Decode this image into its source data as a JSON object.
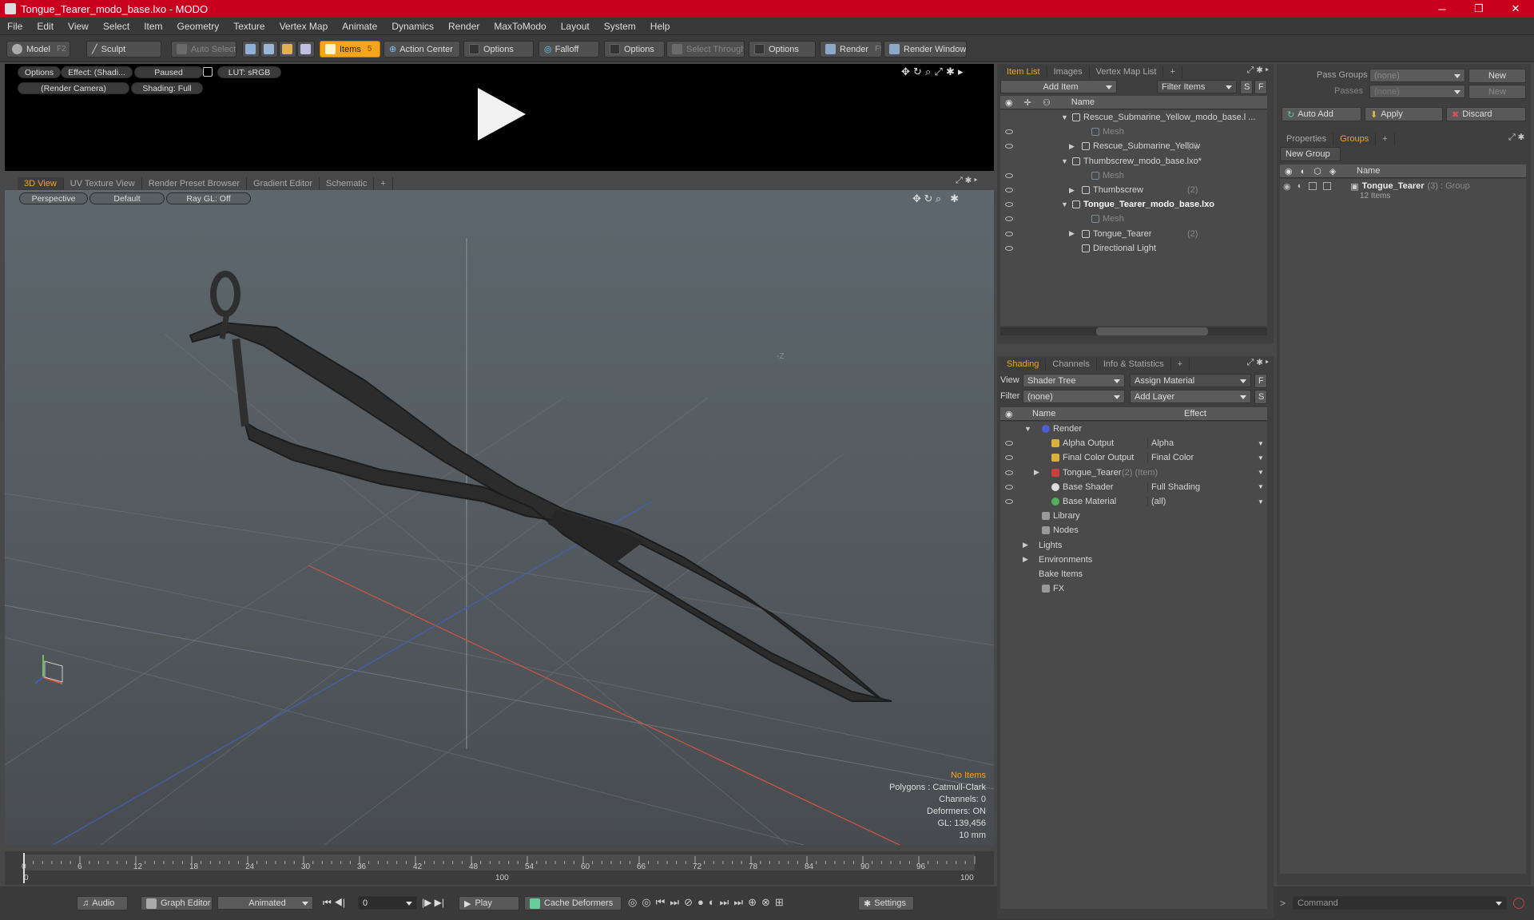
{
  "window": {
    "title": "Tongue_Tearer_modo_base.lxo - MODO",
    "controls": [
      "─",
      "❐",
      "✕"
    ]
  },
  "menu": [
    "File",
    "Edit",
    "View",
    "Select",
    "Item",
    "Geometry",
    "Texture",
    "Vertex Map",
    "Animate",
    "Dynamics",
    "Render",
    "MaxToModo",
    "Layout",
    "System",
    "Help"
  ],
  "toolbar": {
    "model": "Model",
    "model_key": "F2",
    "sculpt": "Sculpt",
    "auto_select": "Auto Select",
    "items": "Items",
    "items_key": "5",
    "action_center": "Action Center",
    "options1": "Options",
    "falloff": "Falloff",
    "options2": "Options",
    "select_through": "Select Through",
    "options3": "Options",
    "render": "Render",
    "render_key": "F9",
    "render_window": "Render Window"
  },
  "preview": {
    "options": "Options",
    "effect": "Effect: (Shadi...",
    "paused": "Paused",
    "lut": "LUT: sRGB",
    "camera": "(Render Camera)",
    "shading": "Shading: Full"
  },
  "viewport_tabs": [
    "3D View",
    "UV Texture View",
    "Render Preset Browser",
    "Gradient Editor",
    "Schematic",
    "+"
  ],
  "viewport": {
    "perspective": "Perspective",
    "default": "Default",
    "raygl": "Ray GL: Off",
    "axis_label": "-Z",
    "stats": {
      "no_items": "No Items",
      "polygons": "Polygons : Catmull-Clark",
      "channels": "Channels: 0",
      "deformers": "Deformers: ON",
      "gl": "GL: 139,456",
      "scale": "10 mm"
    }
  },
  "timeline": {
    "ticks": [
      "0",
      "6",
      "12",
      "18",
      "24",
      "30",
      "36",
      "42",
      "48",
      "54",
      "60",
      "66",
      "72",
      "78",
      "84",
      "90",
      "96"
    ],
    "lower_left": "0",
    "lower_mid": "100",
    "lower_right": "100"
  },
  "bottombar": {
    "audio": "Audio",
    "graph_editor": "Graph Editor",
    "animated": "Animated",
    "frame": "0",
    "play": "Play",
    "cache": "Cache Deformers",
    "settings": "Settings"
  },
  "itemlist": {
    "tabs": [
      "Item List",
      "Images",
      "Vertex Map List",
      "+"
    ],
    "add_item": "Add Item",
    "filter": "Filter Items",
    "s": "S",
    "f": "F",
    "col_name": "Name",
    "rows": [
      {
        "name": "Rescue_Submarine_Yellow_modo_base.l ...",
        "sub": "",
        "indent": 0,
        "bold": false,
        "arrow": "▼",
        "eye": false
      },
      {
        "name": "Mesh",
        "sub": "",
        "indent": 2,
        "bold": false,
        "arrow": "",
        "eye": true,
        "dim": true
      },
      {
        "name": "Rescue_Submarine_Yellow",
        "sub": "(2)",
        "indent": 1,
        "bold": false,
        "arrow": "▶",
        "eye": true
      },
      {
        "name": "Thumbscrew_modo_base.lxo*",
        "sub": "",
        "indent": 0,
        "bold": false,
        "arrow": "▼",
        "eye": false
      },
      {
        "name": "Mesh",
        "sub": "",
        "indent": 2,
        "bold": false,
        "arrow": "",
        "eye": true,
        "dim": true
      },
      {
        "name": "Thumbscrew",
        "sub": "(2)",
        "indent": 1,
        "bold": false,
        "arrow": "▶",
        "eye": true
      },
      {
        "name": "Tongue_Tearer_modo_base.lxo",
        "sub": "",
        "indent": 0,
        "bold": true,
        "arrow": "▼",
        "eye": true
      },
      {
        "name": "Mesh",
        "sub": "",
        "indent": 2,
        "bold": false,
        "arrow": "",
        "eye": true,
        "dim": true
      },
      {
        "name": "Tongue_Tearer",
        "sub": "(2)",
        "indent": 1,
        "bold": false,
        "arrow": "▶",
        "eye": true
      },
      {
        "name": "Directional Light",
        "sub": "",
        "indent": 1,
        "bold": false,
        "arrow": "",
        "eye": true
      }
    ]
  },
  "shading": {
    "tabs": [
      "Shading",
      "Channels",
      "Info & Statistics",
      "+"
    ],
    "view_label": "View",
    "view_value": "Shader Tree",
    "assign": "Assign Material",
    "filter_label": "Filter",
    "filter_value": "(none)",
    "add_layer": "Add Layer",
    "f": "F",
    "s": "S",
    "col_name": "Name",
    "col_effect": "Effect",
    "rows": [
      {
        "name": "Render",
        "sub": "",
        "effect": "",
        "indent": 0,
        "arrow": "▼",
        "eye": false,
        "icon": "#4a5fd0"
      },
      {
        "name": "Alpha Output",
        "sub": "",
        "effect": "Alpha",
        "indent": 1,
        "arrow": "",
        "eye": true,
        "icon": "#d8b040"
      },
      {
        "name": "Final Color Output",
        "sub": "",
        "effect": "Final Color",
        "indent": 1,
        "arrow": "",
        "eye": true,
        "icon": "#d8b040"
      },
      {
        "name": "Tongue_Tearer",
        "sub": "(2) (Item)",
        "effect": "",
        "indent": 1,
        "arrow": "▶",
        "eye": true,
        "icon": "#c84040"
      },
      {
        "name": "Base Shader",
        "sub": "",
        "effect": "Full Shading",
        "indent": 1,
        "arrow": "",
        "eye": true,
        "icon": "#dddddd"
      },
      {
        "name": "Base Material",
        "sub": "",
        "effect": "(all)",
        "indent": 1,
        "arrow": "",
        "eye": true,
        "icon": "#50b060"
      },
      {
        "name": "Library",
        "sub": "",
        "effect": "",
        "indent": 0,
        "arrow": "",
        "eye": false,
        "icon": "#999"
      },
      {
        "name": "Nodes",
        "sub": "",
        "effect": "",
        "indent": 0,
        "arrow": "",
        "eye": false,
        "icon": "#999"
      },
      {
        "name": "Lights",
        "sub": "",
        "effect": "",
        "indent": -1,
        "arrow": "▶",
        "eye": false,
        "icon": ""
      },
      {
        "name": "Environments",
        "sub": "",
        "effect": "",
        "indent": -1,
        "arrow": "▶",
        "eye": false,
        "icon": ""
      },
      {
        "name": "Bake Items",
        "sub": "",
        "effect": "",
        "indent": -1,
        "arrow": "",
        "eye": false,
        "icon": ""
      },
      {
        "name": "FX",
        "sub": "",
        "effect": "",
        "indent": 0,
        "arrow": "",
        "eye": false,
        "icon": "#999"
      }
    ]
  },
  "groups": {
    "pass_groups": "Pass Groups",
    "pass_value": "(none)",
    "new": "New",
    "passes": "Passes",
    "passes_value": "(none)",
    "new2": "New",
    "auto_add": "Auto Add",
    "apply": "Apply",
    "discard": "Discard",
    "tabs": [
      "Properties",
      "Groups",
      "+"
    ],
    "new_group": "New Group",
    "col_name": "Name",
    "group_name": "Tongue_Tearer",
    "group_meta": "(3) : Group",
    "group_count": "12 Items"
  },
  "command": {
    "placeholder": "Command"
  },
  "colors": {
    "accent": "#f4a51c",
    "titlebar": "#c8001e"
  }
}
